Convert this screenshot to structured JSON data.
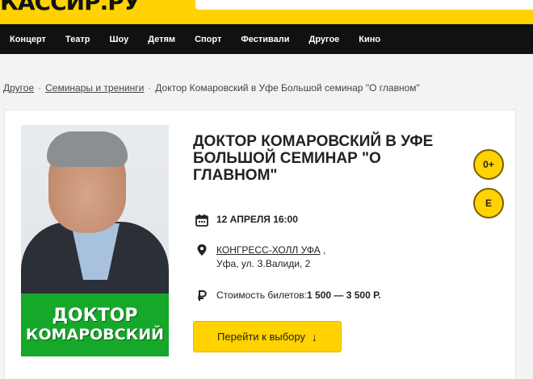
{
  "header": {
    "logo_text": "КАССИР.РУ",
    "search_placeholder": ""
  },
  "nav": {
    "items": [
      "Концерт",
      "Театр",
      "Шоу",
      "Детям",
      "Спорт",
      "Фестивали",
      "Другое",
      "Кино"
    ]
  },
  "breadcrumbs": {
    "items": [
      "Другое",
      "Семинары и тренинги"
    ],
    "current": "Доктор Комаровский в Уфе Большой семинар \"О главном\""
  },
  "event": {
    "title": "ДОКТОР КОМАРОВСКИЙ В УФЕ БОЛЬШОЙ СЕМИНАР \"О ГЛАВНОМ\"",
    "age_badge": "0+",
    "rating_badge": "E",
    "poster_line1": "ДОКТОР",
    "poster_line2": "КОМАРОВСКИЙ",
    "date": "12 АПРЕЛЯ 16:00",
    "venue": "КОНГРЕСС-ХОЛЛ УФА",
    "venue_suffix": " ,",
    "address": "Уфа, ул. З.Валиди, 2",
    "price_label": "Стоимость билетов: ",
    "price_value": "1 500 — 3 500 Р.",
    "cta_label": "Перейти к выбору",
    "cta_arrow": "↓"
  },
  "icons": {
    "calendar": "calendar-icon",
    "location": "location-pin-icon",
    "ruble": "ruble-icon"
  },
  "colors": {
    "brand_yellow": "#ffd200",
    "nav_bg": "#111111",
    "poster_green": "#15a82a"
  }
}
